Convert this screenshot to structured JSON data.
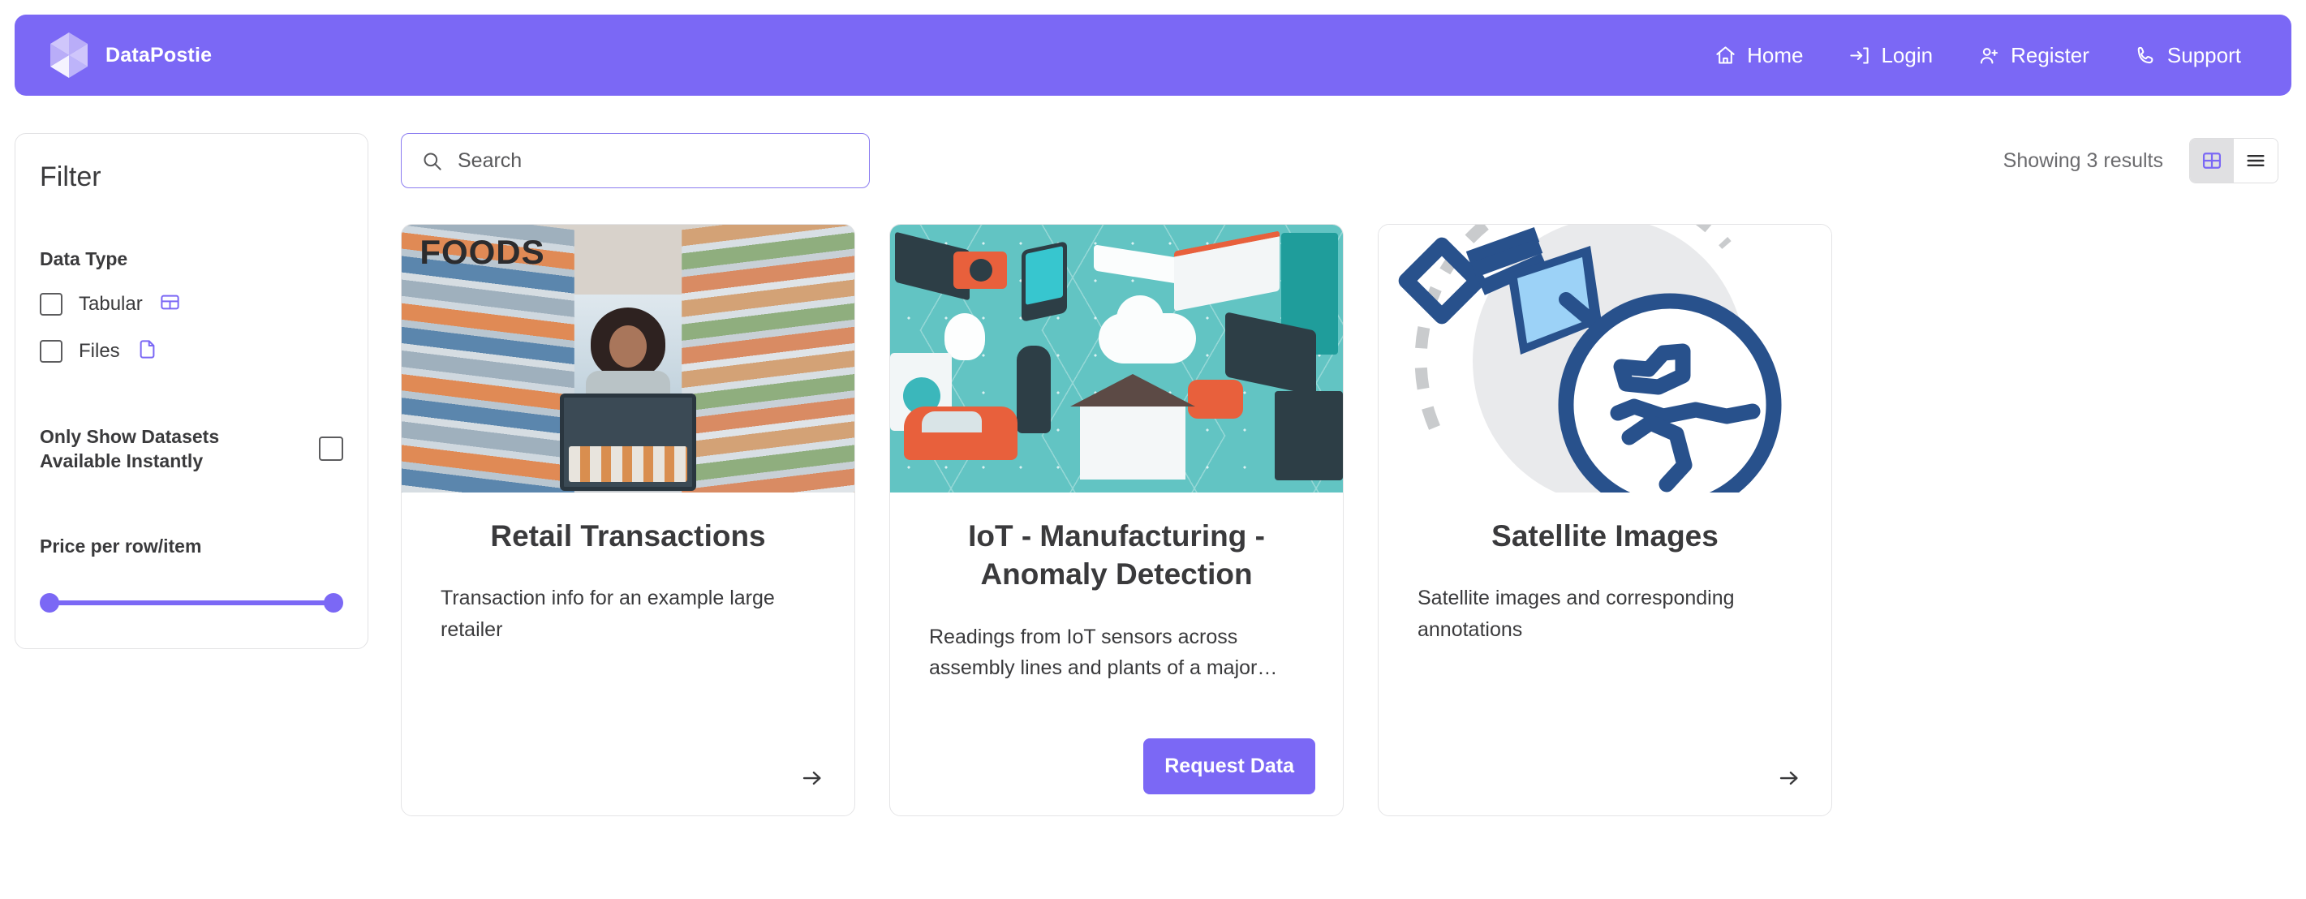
{
  "brand": {
    "name": "DataPostie",
    "logo_icon": "datapostie-logo-icon",
    "header_color": "#7B68F5"
  },
  "nav": {
    "items": [
      {
        "label": "Home",
        "icon": "home-icon"
      },
      {
        "label": "Login",
        "icon": "login-arrow-icon"
      },
      {
        "label": "Register",
        "icon": "user-plus-icon"
      },
      {
        "label": "Support",
        "icon": "phone-icon"
      }
    ]
  },
  "filter": {
    "title": "Filter",
    "data_type": {
      "label": "Data Type",
      "options": [
        {
          "label": "Tabular",
          "icon": "table-grid-icon",
          "checked": false
        },
        {
          "label": "Files",
          "icon": "file-document-icon",
          "checked": false
        }
      ]
    },
    "instant": {
      "label": "Only Show Datasets Available Instantly",
      "checked": false
    },
    "price": {
      "label": "Price per row/item",
      "min_handle_position": "0%",
      "max_handle_position": "100%",
      "track_color": "#7B68F5"
    }
  },
  "search": {
    "placeholder": "Search",
    "value": "",
    "icon": "search-icon",
    "border_color": "#8b7cf0"
  },
  "results_bar": {
    "count_text": "Showing 3 results",
    "views": [
      {
        "name": "grid",
        "icon": "grid-view-icon",
        "active": true
      },
      {
        "name": "list",
        "icon": "list-view-icon",
        "active": false
      }
    ]
  },
  "cards": [
    {
      "title": "Retail Transactions",
      "description": "Transaction info for an example large retailer",
      "media": "grocery-store-photo",
      "action": {
        "type": "arrow",
        "icon": "arrow-right-icon",
        "label": ""
      }
    },
    {
      "title": "IoT - Manufacturing - Anomaly Detection",
      "description": "Readings from IoT sensors across assembly lines and plants of a major…",
      "media": "iot-network-illustration",
      "action": {
        "type": "button",
        "icon": "",
        "label": "Request Data"
      }
    },
    {
      "title": "Satellite Images",
      "description": "Satellite images and corresponding annotations",
      "media": "satellite-globe-illustration",
      "action": {
        "type": "arrow",
        "icon": "arrow-right-icon",
        "label": ""
      }
    }
  ],
  "colors": {
    "accent": "#7B68F5",
    "text": "#3a3a3c",
    "muted": "#6b6b6e",
    "card_border": "#e4e4e6"
  }
}
